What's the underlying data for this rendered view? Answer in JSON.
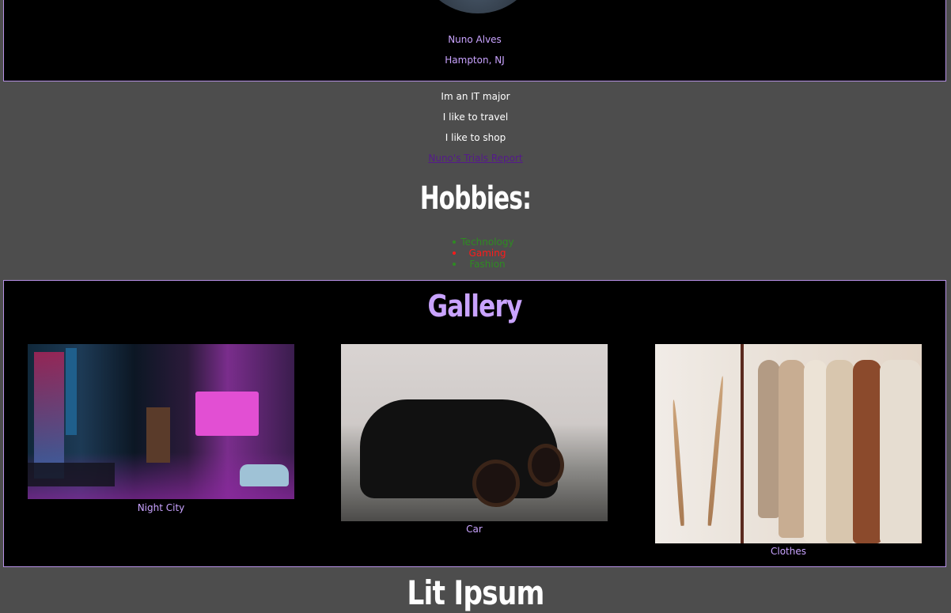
{
  "profile": {
    "name": "Nuno Alves",
    "location": "Hampton, NJ"
  },
  "about": {
    "lines": [
      "Im an IT major",
      "I like to travel",
      "I like to shop"
    ],
    "report_link": "Nuno's Trials Report"
  },
  "hobbies": {
    "title": "Hobbies:",
    "items": [
      {
        "label": "Technology",
        "color": "#2e8b22"
      },
      {
        "label": "Gaming",
        "color": "#ff1a1a"
      },
      {
        "label": "Fashion",
        "color": "#2e8b22"
      }
    ]
  },
  "gallery": {
    "title": "Gallery",
    "photos": [
      {
        "caption": "Night City"
      },
      {
        "caption": "Car"
      },
      {
        "caption": "Clothes"
      }
    ]
  },
  "lit_section": {
    "title": "Lit Ipsum"
  },
  "colors": {
    "page_background": "#4d4d4d",
    "panel_background": "#000000",
    "accent": "#c9a3ff",
    "border": "#b690e6"
  }
}
